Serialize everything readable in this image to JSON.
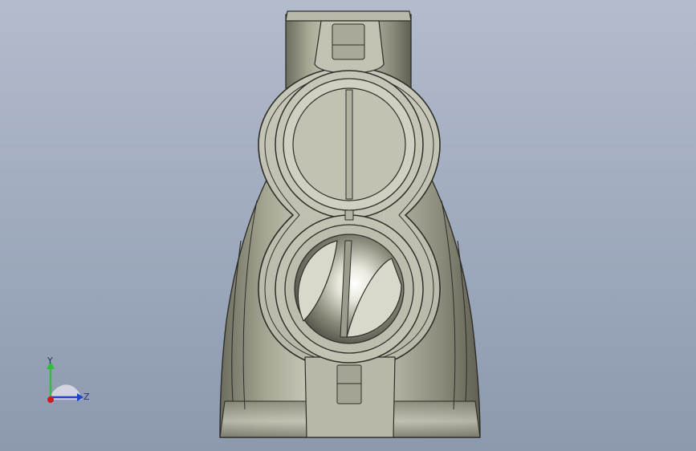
{
  "viewport": {
    "background_top": "#b3bccc",
    "background_bottom": "#8c99ae",
    "model_color": "#c9c9bb",
    "model_edge_color": "#2e2e28"
  },
  "triad": {
    "y_label": "Y",
    "z_label": "Z",
    "y_axis_color": "#2fbf3a",
    "z_axis_color": "#1d43c8",
    "x_axis_color": "#d11b1b"
  }
}
